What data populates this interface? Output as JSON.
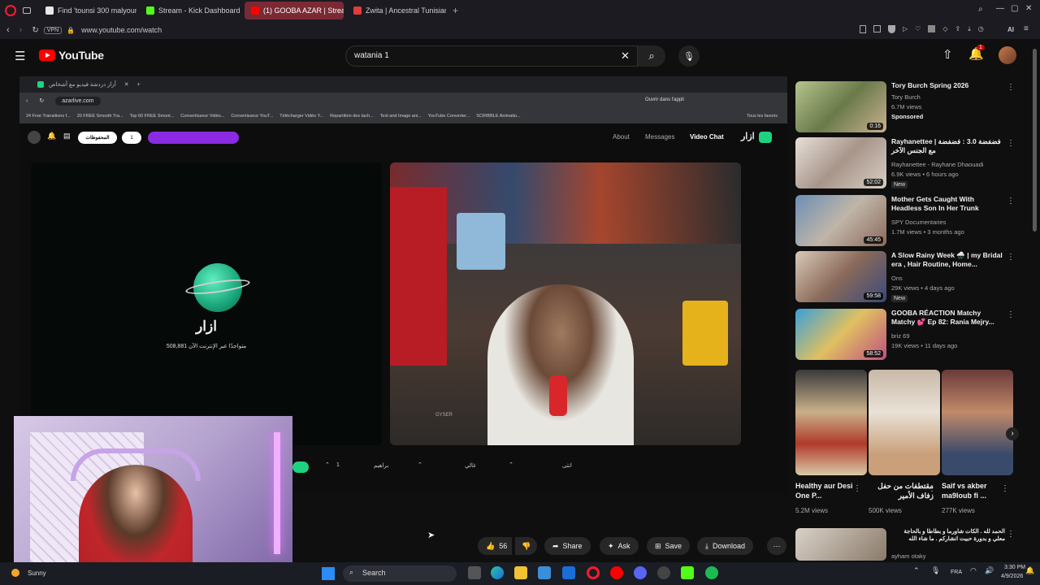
{
  "browser": {
    "tabs": [
      {
        "label": "Find 'tounsi 300 malyoun",
        "color": "#e8e8e8"
      },
      {
        "label": "Stream - Kick Dashboard",
        "color": "#53fc18"
      },
      {
        "label": "(1) GOOBA AZAR | Stream",
        "color": "#ff0000"
      },
      {
        "label": "Zwita | Ancestral Tunisian",
        "color": "#e03c3c"
      }
    ],
    "url": "www.youtube.com/watch",
    "vpn": "VPN",
    "ai_label": "AI"
  },
  "youtube": {
    "logo": "YouTube",
    "search_value": "watania 1",
    "notification_count": "1"
  },
  "inner_browser": {
    "tab_title": "أزار دردشة فيديو مع أشخاص",
    "url": "azarlive.com",
    "open_app": "Ouvrir dans l'appli",
    "bookmarks": [
      "24 Free Transitions f...",
      "20 FREE Smooth Tra...",
      "Top 60 FREE Smoot...",
      "Convertisseur Vidéo...",
      "Convertisseur YouT...",
      "Télécharger Vidéo Y...",
      "Repartition des tach...",
      "Text and Image ani...",
      "YouTube Converter...",
      "SCRIBBLE Animatio..."
    ],
    "all_favorites": "Tous les favoris"
  },
  "azar": {
    "nav": [
      "About",
      "Messages",
      "Video Chat"
    ],
    "brand": "ازار",
    "saved_pill": "المحفوظات",
    "count_pill": "1",
    "online_text": "508,881 متواجدًا عبر الإنترنت الآن",
    "bottom_labels": [
      "براهيم",
      "غالي",
      "انثى"
    ],
    "bottom_count": "1",
    "cam_watermark": "GYSER"
  },
  "actions": {
    "likes": "56",
    "share": "Share",
    "ask": "Ask",
    "save": "Save",
    "download": "Download"
  },
  "recommendations": [
    {
      "title": "Tory Burch Spring 2026",
      "channel": "Tory Burch",
      "meta": "6.7M views",
      "extra": "Sponsored",
      "duration": "0:16"
    },
    {
      "title": "Rayhanettee | فضفضة 3.0 : فضفضة مع الجنس الآخر",
      "channel": "Rayhanettee - Rayhane Dhaouadi",
      "meta": "6.9K views • 6 hours ago",
      "extra": "New",
      "duration": "52:02"
    },
    {
      "title": "Mother Gets Caught With Headless Son In Her Trunk",
      "channel": "SPY Documentaries",
      "meta": "1.7M views • 3 months ago",
      "extra": "",
      "duration": "45:45"
    },
    {
      "title": "A Slow Rainy Week 🌧️ | my Bridal era , Hair Routine, Home...",
      "channel": "Ons",
      "meta": "29K views • 4 days ago",
      "extra": "New",
      "duration": "59:58"
    },
    {
      "title": "GOOBA RÉACTION Matchy Matchy 💕 Ep 82: Rania Mejry...",
      "channel": "briz 69",
      "meta": "19K views • 11 days ago",
      "extra": "",
      "duration": "58:52"
    }
  ],
  "shorts": [
    {
      "title": "Healthy aur Desi One P...",
      "views": "5.2M views"
    },
    {
      "title": "مقتطفات من حفل زفاف الأمير",
      "views": "500K views"
    },
    {
      "title": "Saif vs akber ma9loub fi ...",
      "views": "277K views"
    }
  ],
  "next_rec": {
    "title": "الحمد لله . الكات شاورما و بطاطا و بالحاجة معلي و بدورة حبيت انشاركم . ما شاء الله",
    "channel": "ayham otaky"
  },
  "taskbar": {
    "weather": "Sunny",
    "search": "Search",
    "lang": "FRA",
    "time": "3:30 PM",
    "date": "4/9/2026"
  },
  "colors": {
    "yt_red": "#ff0000",
    "accent": "#3ea6ff",
    "azar_green": "#1ed37f",
    "purple_pill": "#8a2be2"
  }
}
